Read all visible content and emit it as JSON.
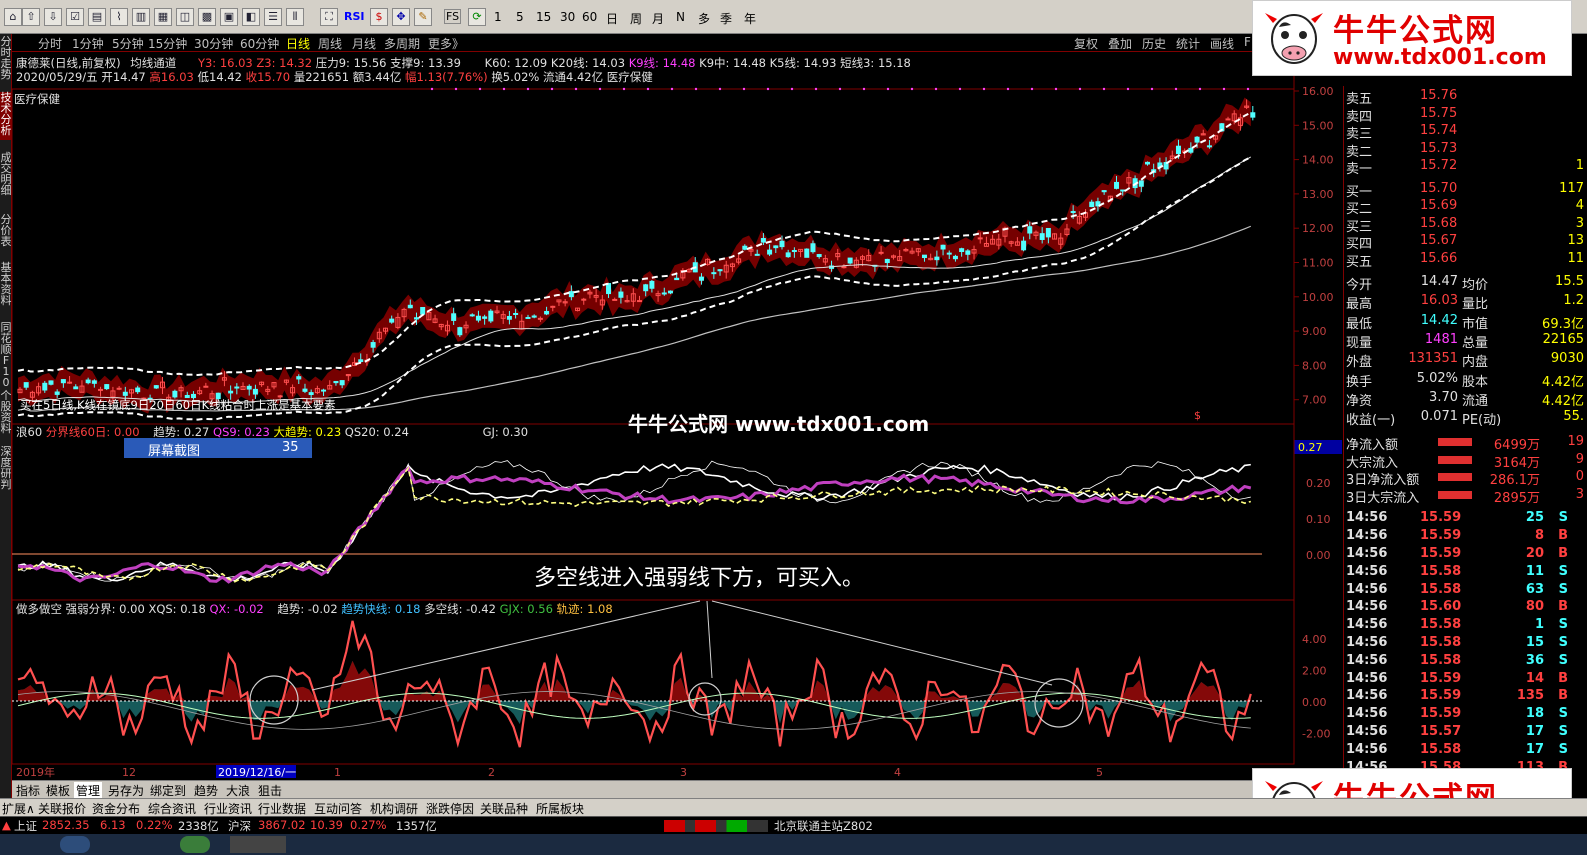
{
  "colors": {
    "up": "#ff3030",
    "down": "#40ffff",
    "accent": "#ffff00",
    "bg": "#000000",
    "grid": "#800000"
  },
  "toolbar": {
    "icons": [
      "home-icon",
      "back-icon",
      "forward-icon",
      "up-icon",
      "down-icon",
      "grid-icon",
      "chart-icon",
      "candle-icon",
      "layout-icon",
      "window-icon",
      "window-icon",
      "table-icon"
    ],
    "rsi_label": "RSI",
    "fs_label": "FS",
    "day_counts": [
      "1",
      "5",
      "15",
      "30",
      "60"
    ],
    "period_shortcuts": [
      "日",
      "周",
      "月",
      "N",
      "多",
      "季",
      "年"
    ]
  },
  "periods": [
    "分时",
    "1分钟",
    "5分钟",
    "15分钟",
    "30分钟",
    "60分钟",
    "日线",
    "周线",
    "月线",
    "多周期",
    "更多》"
  ],
  "active_period": "日线",
  "right_tools": [
    "复权",
    "叠加",
    "历史",
    "统计",
    "画线",
    "F"
  ],
  "left_tabs": [
    "分时走势",
    "技术分析",
    "成交明细",
    "分价表",
    "基本资料",
    "同花顺F10",
    "个股资料",
    "深度研判"
  ],
  "stock": {
    "name": "康德莱(日线,前复权)",
    "indicator": "均线通道",
    "y3": "Y3: 16.03",
    "z3": "Z3: 14.32",
    "pressure": "压力9: 15.56",
    "support": "支撑9: 13.39",
    "k60": "K60: 12.09",
    "k20": "K20线: 14.03",
    "k9": "K9线: 14.48",
    "k9mid": "K9中: 14.48",
    "k5": "K5线: 14.93",
    "short3": "短线3: 15.18",
    "date": "2020/05/29/五",
    "open": "开14.47",
    "high": "高16.03",
    "low": "低14.42",
    "close": "收15.70",
    "vol": "量221651",
    "amount": "额3.44亿",
    "change": "幅1.13(7.76%)",
    "turnover": "换5.02%",
    "float": "流通4.42亿",
    "sector": "医疗保健",
    "sector2": "医疗保健",
    "hint": "买在5日线,K线在镜底9日20日60日K线粘合时上涨是基本要素",
    "yticks": [
      "16.00",
      "15.00",
      "14.00",
      "13.00",
      "12.00",
      "11.00",
      "10.00",
      "9.00",
      "8.00",
      "7.00"
    ]
  },
  "panel2": {
    "name": "浪60",
    "fenjie": "分界线60日: 0.00",
    "trend": "趋势: 0.27",
    "qs9": "QS9: 0.23",
    "bigtrend": "大趋势: 0.23",
    "qs20": "QS20: 0.24",
    "gj": "GJ: 0.30",
    "current": "0.27",
    "yticks": [
      "0.20",
      "0.10",
      "0.00"
    ]
  },
  "panel3": {
    "name": "做多做空",
    "strong": "强弱分界: 0.00",
    "xqs": "XQS: 0.18",
    "qx": "QX: -0.02",
    "trend": "趋势: -0.02",
    "fast": "趋势快线: 0.18",
    "duokong": "多空线: -0.42",
    "gjx": "GJX: 0.56",
    "track": "轨迹: 1.08",
    "yticks": [
      "4.00",
      "2.00",
      "0.00",
      "-2.00"
    ]
  },
  "xaxis": {
    "labels": [
      "2019年",
      "12",
      "2019/12/16/一",
      "1",
      "2",
      "3",
      "4",
      "5"
    ]
  },
  "screenshot_badge": {
    "label": "屏幕截图",
    "count": "35"
  },
  "watermark_center": "牛牛公式网 www.tdx001.com",
  "annotation": "多空线进入强弱线下方，可买入。",
  "logo": {
    "title": "牛牛公式网",
    "url": "www.tdx001.com"
  },
  "quote": {
    "sell": [
      {
        "label": "卖五",
        "price": "15.76"
      },
      {
        "label": "卖四",
        "price": "15.75"
      },
      {
        "label": "卖三",
        "price": "15.74"
      },
      {
        "label": "卖二",
        "price": "15.73"
      },
      {
        "label": "卖一",
        "price": "15.72",
        "vol": "1"
      }
    ],
    "buy": [
      {
        "label": "买一",
        "price": "15.70",
        "vol": "117"
      },
      {
        "label": "买二",
        "price": "15.69",
        "vol": "4"
      },
      {
        "label": "买三",
        "price": "15.68",
        "vol": "3"
      },
      {
        "label": "买四",
        "price": "15.67",
        "vol": "13"
      },
      {
        "label": "买五",
        "price": "15.66",
        "vol": "11"
      }
    ],
    "stats": [
      {
        "l1": "今开",
        "v1": "14.47",
        "l2": "均价",
        "v2": "15.5"
      },
      {
        "l1": "最高",
        "v1": "16.03",
        "l2": "量比",
        "v2": "1.2"
      },
      {
        "l1": "最低",
        "v1": "14.42",
        "l2": "市值",
        "v2": "69.3亿"
      },
      {
        "l1": "现量",
        "v1": "1481",
        "l2": "总量",
        "v2": "22165"
      },
      {
        "l1": "外盘",
        "v1": "131351",
        "l2": "内盘",
        "v2": "9030"
      },
      {
        "l1": "换手",
        "v1": "5.02%",
        "l2": "股本",
        "v2": "4.42亿"
      },
      {
        "l1": "净资",
        "v1": "3.70",
        "l2": "流通",
        "v2": "4.42亿"
      },
      {
        "l1": "收益(一)",
        "v1": "0.071",
        "l2": "PE(动)",
        "v2": "55."
      }
    ],
    "flows": [
      {
        "label": "净流入额",
        "value": "6499万",
        "pct": "19"
      },
      {
        "label": "大宗流入",
        "value": "3164万",
        "pct": "9"
      },
      {
        "label": "3日净流入额",
        "value": "286.1万",
        "pct": "0"
      },
      {
        "label": "3日大宗流入",
        "value": "2895万",
        "pct": "3"
      }
    ],
    "ticks": [
      {
        "t": "14:56",
        "p": "15.59",
        "v": "25",
        "s": "S"
      },
      {
        "t": "14:56",
        "p": "15.59",
        "v": "8",
        "s": "B"
      },
      {
        "t": "14:56",
        "p": "15.59",
        "v": "20",
        "s": "B"
      },
      {
        "t": "14:56",
        "p": "15.58",
        "v": "11",
        "s": "S"
      },
      {
        "t": "14:56",
        "p": "15.58",
        "v": "63",
        "s": "S"
      },
      {
        "t": "14:56",
        "p": "15.60",
        "v": "80",
        "s": "B"
      },
      {
        "t": "14:56",
        "p": "15.58",
        "v": "1",
        "s": "S"
      },
      {
        "t": "14:56",
        "p": "15.58",
        "v": "15",
        "s": "S"
      },
      {
        "t": "14:56",
        "p": "15.58",
        "v": "36",
        "s": "S"
      },
      {
        "t": "14:56",
        "p": "15.59",
        "v": "14",
        "s": "B"
      },
      {
        "t": "14:56",
        "p": "15.59",
        "v": "135",
        "s": "B"
      },
      {
        "t": "14:56",
        "p": "15.59",
        "v": "18",
        "s": "S"
      },
      {
        "t": "14:56",
        "p": "15.57",
        "v": "17",
        "s": "S"
      },
      {
        "t": "14:56",
        "p": "15.58",
        "v": "17",
        "s": "S"
      },
      {
        "t": "14:56",
        "p": "15.58",
        "v": "113",
        "s": "B"
      }
    ]
  },
  "bottom1": [
    "指标",
    "模板",
    "管理",
    "另存为",
    "绑定到",
    "趋势",
    "大浪",
    "狙击"
  ],
  "bottom2": [
    "扩展∧",
    "关联报价",
    "资金分布",
    "综合资讯",
    "行业资讯",
    "行业数据",
    "互动问答",
    "机构调研",
    "涨跌停因",
    "关联品种",
    "所属板块"
  ],
  "status": {
    "sh_label": "上证",
    "sh_val": "2852.35",
    "sh_chg": "6.13",
    "sh_pct": "0.22%",
    "sh_amt": "2338亿",
    "hs_label": "沪深",
    "hs_val": "3867.02",
    "hs_chg": "10.39",
    "hs_pct": "0.27%",
    "hs_amt": "1357亿",
    "server": "北京联通主站Z802"
  }
}
